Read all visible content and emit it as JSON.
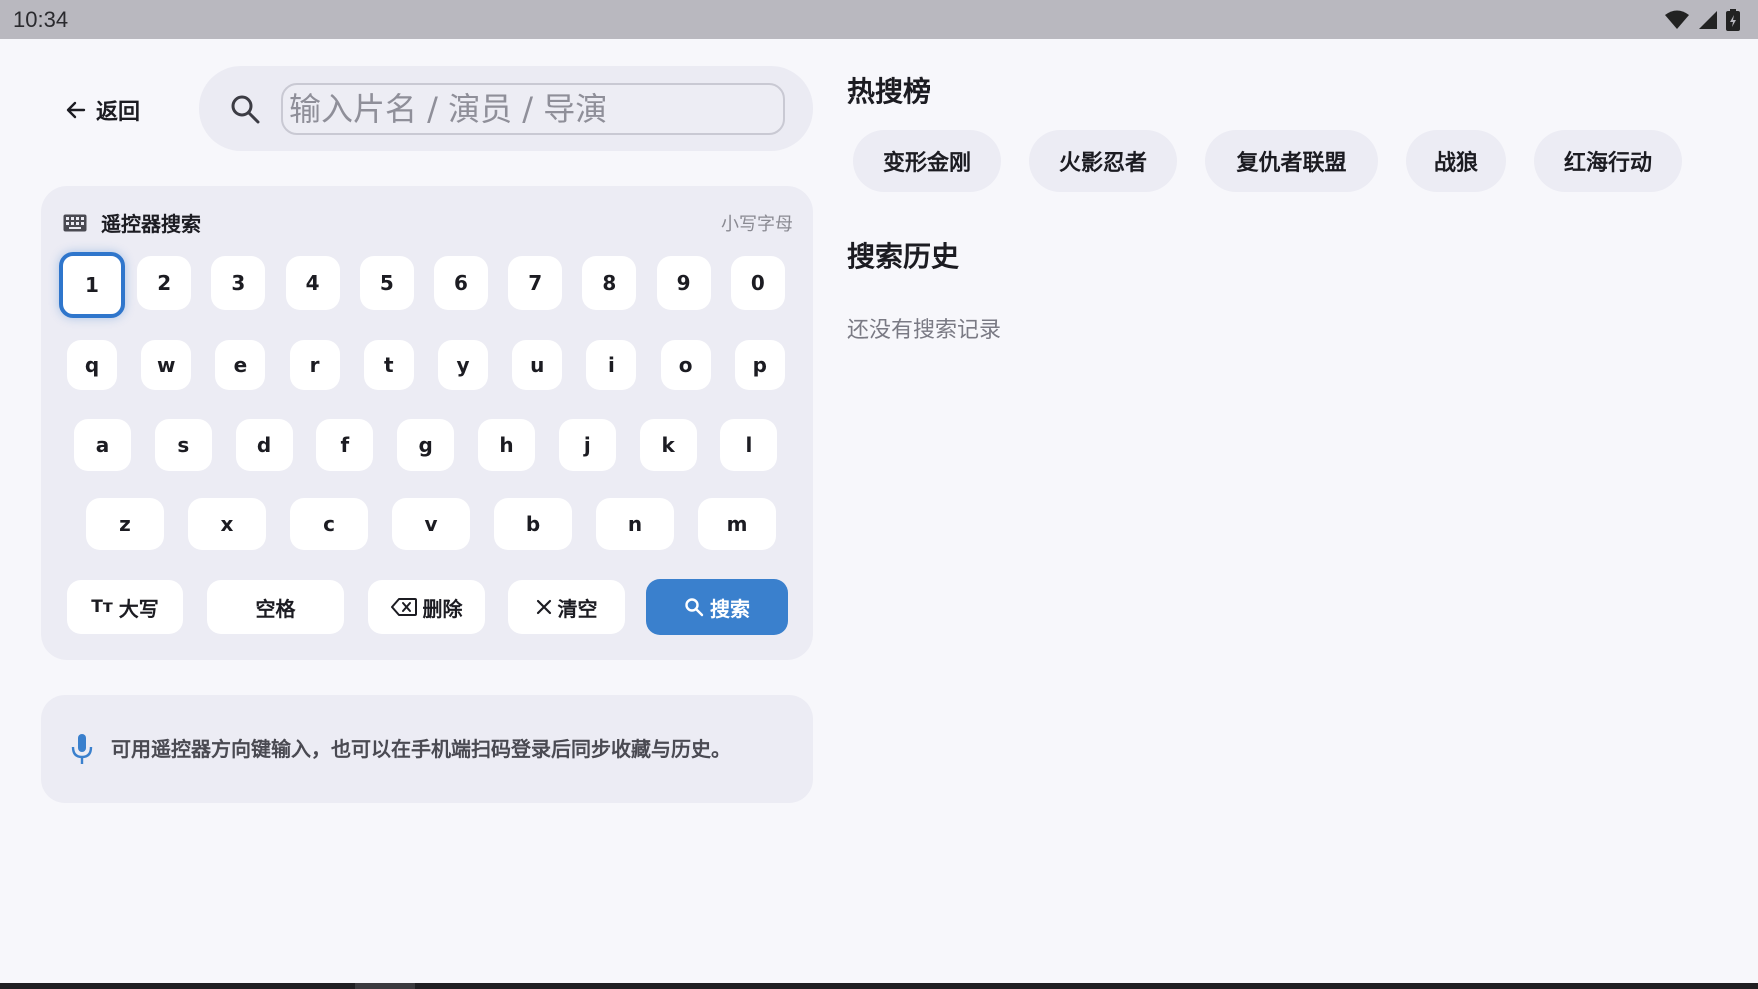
{
  "status_bar": {
    "time": "10:34"
  },
  "header": {
    "back_label": "返回",
    "search_placeholder": "输入片名 / 演员 / 导演",
    "search_value": ""
  },
  "keyboard": {
    "title": "遥控器搜索",
    "mode": "小写字母",
    "rows": [
      [
        "1",
        "2",
        "3",
        "4",
        "5",
        "6",
        "7",
        "8",
        "9",
        "0"
      ],
      [
        "q",
        "w",
        "e",
        "r",
        "t",
        "y",
        "u",
        "i",
        "o",
        "p"
      ],
      [
        "a",
        "s",
        "d",
        "f",
        "g",
        "h",
        "j",
        "k",
        "l"
      ],
      [
        "z",
        "x",
        "c",
        "v",
        "b",
        "n",
        "m"
      ]
    ],
    "focused_key": "1",
    "actions": {
      "caps_icon": "Tт",
      "caps_label": "大写",
      "space_label": "空格",
      "delete_label": "删除",
      "clear_label": "清空",
      "search_label": "搜索"
    }
  },
  "tip": {
    "text": "可用遥控器方向键输入，也可以在手机端扫码登录后同步收藏与历史。"
  },
  "hot": {
    "title": "热搜榜",
    "tags": [
      "变形金刚",
      "火影忍者",
      "复仇者联盟",
      "战狼",
      "红海行动"
    ]
  },
  "history": {
    "title": "搜索历史",
    "empty_text": "还没有搜索记录"
  },
  "colors": {
    "accent": "#3a80cd",
    "panel": "#ececf4",
    "background": "#f7f7fb"
  }
}
